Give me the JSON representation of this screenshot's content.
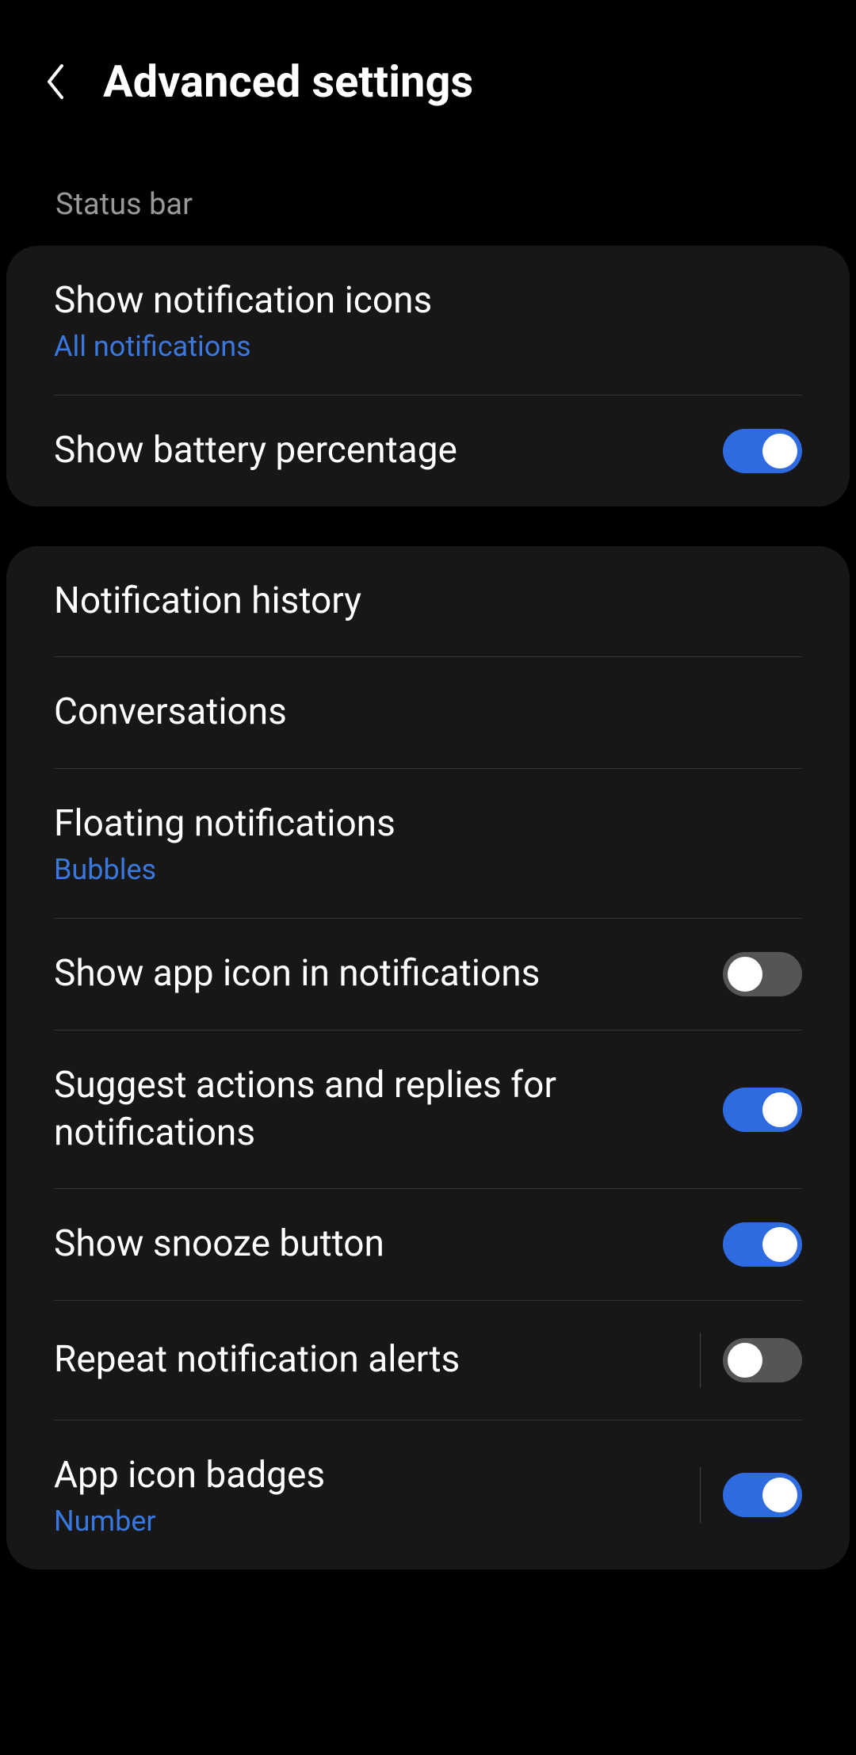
{
  "header": {
    "title": "Advanced settings"
  },
  "sections": {
    "status_bar": {
      "label": "Status bar",
      "show_notification_icons": {
        "title": "Show notification icons",
        "subtitle": "All notifications"
      },
      "show_battery_percentage": {
        "title": "Show battery percentage",
        "enabled": true
      }
    },
    "main": {
      "notification_history": {
        "title": "Notification history"
      },
      "conversations": {
        "title": "Conversations"
      },
      "floating_notifications": {
        "title": "Floating notifications",
        "subtitle": "Bubbles"
      },
      "show_app_icon": {
        "title": "Show app icon in notifications",
        "enabled": false
      },
      "suggest_actions": {
        "title": "Suggest actions and replies for notifications",
        "enabled": true
      },
      "show_snooze": {
        "title": "Show snooze button",
        "enabled": true
      },
      "repeat_alerts": {
        "title": "Repeat notification alerts",
        "enabled": false
      },
      "app_icon_badges": {
        "title": "App icon badges",
        "subtitle": "Number",
        "enabled": true
      }
    }
  }
}
